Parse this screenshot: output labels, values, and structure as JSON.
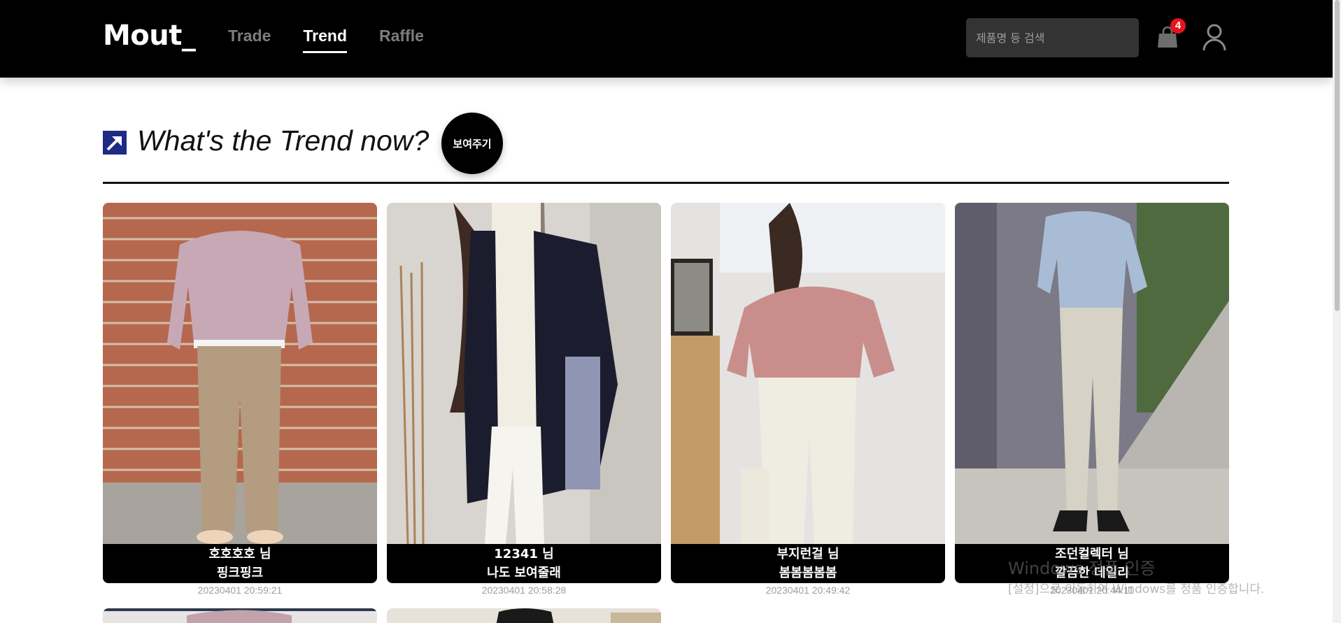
{
  "header": {
    "logo": "Mout_",
    "nav": [
      {
        "label": "Trade",
        "active": false
      },
      {
        "label": "Trend",
        "active": true
      },
      {
        "label": "Raffle",
        "active": false
      }
    ],
    "search_placeholder": "제품명 등 검색",
    "cart_count": "4",
    "icons": [
      "shopping-bag-icon",
      "user-icon"
    ]
  },
  "section": {
    "title": "What's the Trend now?",
    "show_button": "보여주기",
    "icon": "trend-arrow-icon"
  },
  "posts": [
    {
      "author": "호호호호 님",
      "title": "핑크핑크",
      "date": "20230401 20:59:21"
    },
    {
      "author": "12341 님",
      "title": "나도 보여줄래",
      "date": "20230401 20:58:28"
    },
    {
      "author": "부지런걸 님",
      "title": "봄봄봄봄봄",
      "date": "20230401 20:49:42"
    },
    {
      "author": "조던컬렉터 님",
      "title": "깔끔한 데일리",
      "date": "20230401 20:44:11"
    }
  ],
  "watermark": {
    "line1": "Windows 정품 인증",
    "line2": "[설정]으로 이동하여 Windows를 정품 인증합니다."
  },
  "colors": {
    "header_bg": "#000000",
    "badge": "#e8131c",
    "trend_icon": "#1f2a84"
  }
}
